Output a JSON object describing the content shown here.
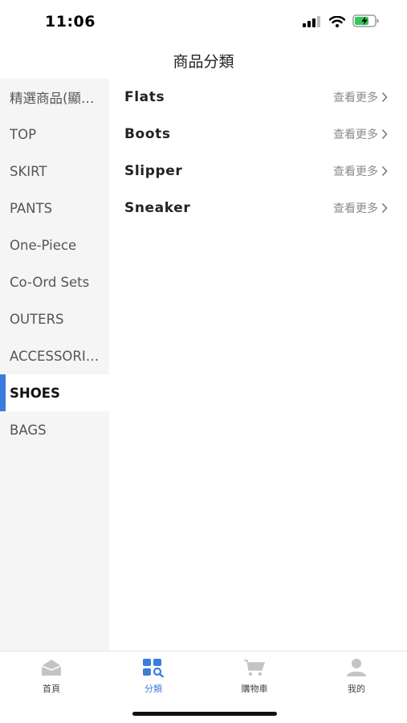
{
  "status_bar": {
    "time": "11:06",
    "icons": [
      "signal-icon",
      "wifi-icon",
      "battery-charging-icon"
    ]
  },
  "header": {
    "title": "商品分類"
  },
  "sidebar": {
    "items": [
      {
        "label": "精選商品(顯…",
        "active": false
      },
      {
        "label": "TOP",
        "active": false
      },
      {
        "label": "SKIRT",
        "active": false
      },
      {
        "label": "PANTS",
        "active": false
      },
      {
        "label": "One-Piece",
        "active": false
      },
      {
        "label": "Co-Ord Sets",
        "active": false
      },
      {
        "label": "OUTERS",
        "active": false
      },
      {
        "label": "ACCESSORI…",
        "active": false
      },
      {
        "label": "SHOES",
        "active": true
      },
      {
        "label": "BAGS",
        "active": false
      }
    ]
  },
  "categories": {
    "items": [
      {
        "name": "Flats",
        "more": "查看更多"
      },
      {
        "name": "Boots",
        "more": "查看更多"
      },
      {
        "name": "Slipper",
        "more": "查看更多"
      },
      {
        "name": "Sneaker",
        "more": "查看更多"
      }
    ]
  },
  "tabbar": {
    "tabs": [
      {
        "label": "首頁",
        "icon": "home-icon",
        "active": false
      },
      {
        "label": "分類",
        "icon": "category-icon",
        "active": true
      },
      {
        "label": "購物車",
        "icon": "cart-icon",
        "active": false
      },
      {
        "label": "我的",
        "icon": "profile-icon",
        "active": false
      }
    ]
  },
  "colors": {
    "accent": "#3b7ddd",
    "sidebar_bg": "#f5f5f5",
    "inactive_icon": "#c4c4c4"
  }
}
